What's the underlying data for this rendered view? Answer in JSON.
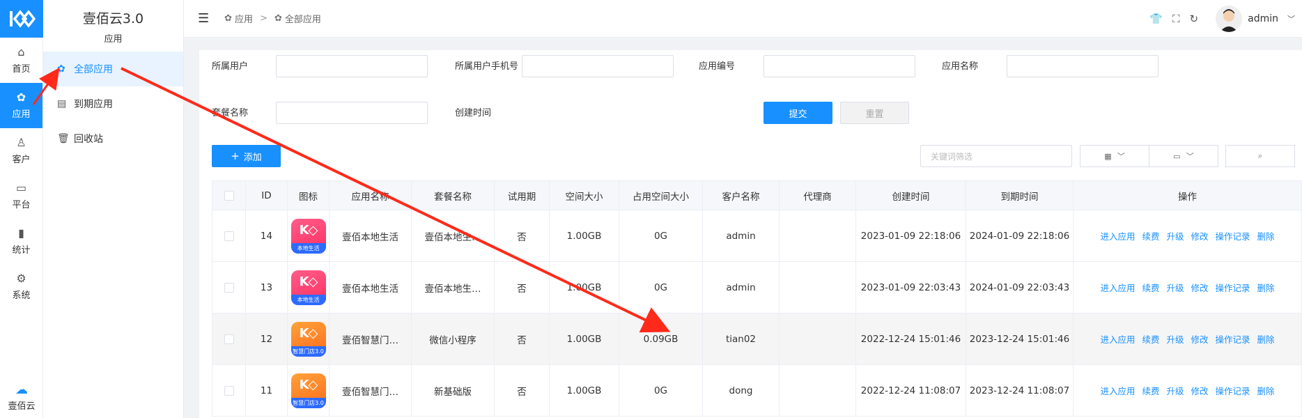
{
  "rail": {
    "items": [
      {
        "label": "首页",
        "icon": "home-icon"
      },
      {
        "label": "应用",
        "icon": "apps-icon"
      },
      {
        "label": "客户",
        "icon": "user-icon"
      },
      {
        "label": "平台",
        "icon": "monitor-icon"
      },
      {
        "label": "统计",
        "icon": "bar-chart-icon"
      },
      {
        "label": "系统",
        "icon": "gear-icon"
      }
    ],
    "bottom_label": "壹佰云"
  },
  "sub": {
    "title": "壹佰云3.0",
    "subtitle": "应用",
    "items": [
      {
        "label": "全部应用"
      },
      {
        "label": "到期应用"
      },
      {
        "label": "回收站"
      }
    ]
  },
  "breadcrumb": {
    "level1": "应用",
    "sep": ">",
    "level2": "全部应用"
  },
  "user": {
    "name": "admin"
  },
  "filters": {
    "owner_user": "所属用户",
    "owner_phone": "所属用户手机号",
    "app_no": "应用编号",
    "app_name": "应用名称",
    "package_name": "套餐名称",
    "created_time": "创建时间",
    "submit": "提交",
    "reset": "重置"
  },
  "toolbar": {
    "add": "添加",
    "add_icon": "+",
    "keyword_placeholder": "关键词筛选"
  },
  "table": {
    "headers": [
      "ID",
      "图标",
      "应用名称",
      "套餐名称",
      "试用期",
      "空间大小",
      "占用空间大小",
      "客户名称",
      "代理商",
      "创建时间",
      "到期时间",
      "操作"
    ],
    "ops": [
      "进入应用",
      "续费",
      "升级",
      "修改",
      "操作记录",
      "删除"
    ],
    "rows": [
      {
        "id": "14",
        "icon_text": "本地生活",
        "app_name": "壹佰本地生活",
        "package": "壹佰本地生…",
        "trial": "否",
        "space": "1.00GB",
        "used": "0G",
        "customer": "admin",
        "agent": "",
        "created": "2023-01-09 22:18:06",
        "expire": "2024-01-09 22:18:06"
      },
      {
        "id": "13",
        "icon_text": "本地生活",
        "app_name": "壹佰本地生活",
        "package": "壹佰本地生…",
        "trial": "否",
        "space": "1.00GB",
        "used": "0G",
        "customer": "admin",
        "agent": "",
        "created": "2023-01-09 22:03:43",
        "expire": "2024-01-09 22:03:43"
      },
      {
        "id": "12",
        "icon_text": "智慧门店3.0",
        "app_name": "壹佰智慧门…",
        "package": "微信小程序",
        "trial": "否",
        "space": "1.00GB",
        "used": "0.09GB",
        "customer": "tian02",
        "agent": "",
        "created": "2022-12-24 15:01:46",
        "expire": "2023-12-24 15:01:46"
      },
      {
        "id": "11",
        "icon_text": "智慧门店3.0",
        "app_name": "壹佰智慧门…",
        "package": "新基础版",
        "trial": "否",
        "space": "1.00GB",
        "used": "0G",
        "customer": "dong",
        "agent": "",
        "created": "2022-12-24 11:08:07",
        "expire": "2023-12-24 11:08:07"
      }
    ]
  },
  "colors": {
    "primary": "#1890ff",
    "annotation": "#ff2a1a"
  }
}
